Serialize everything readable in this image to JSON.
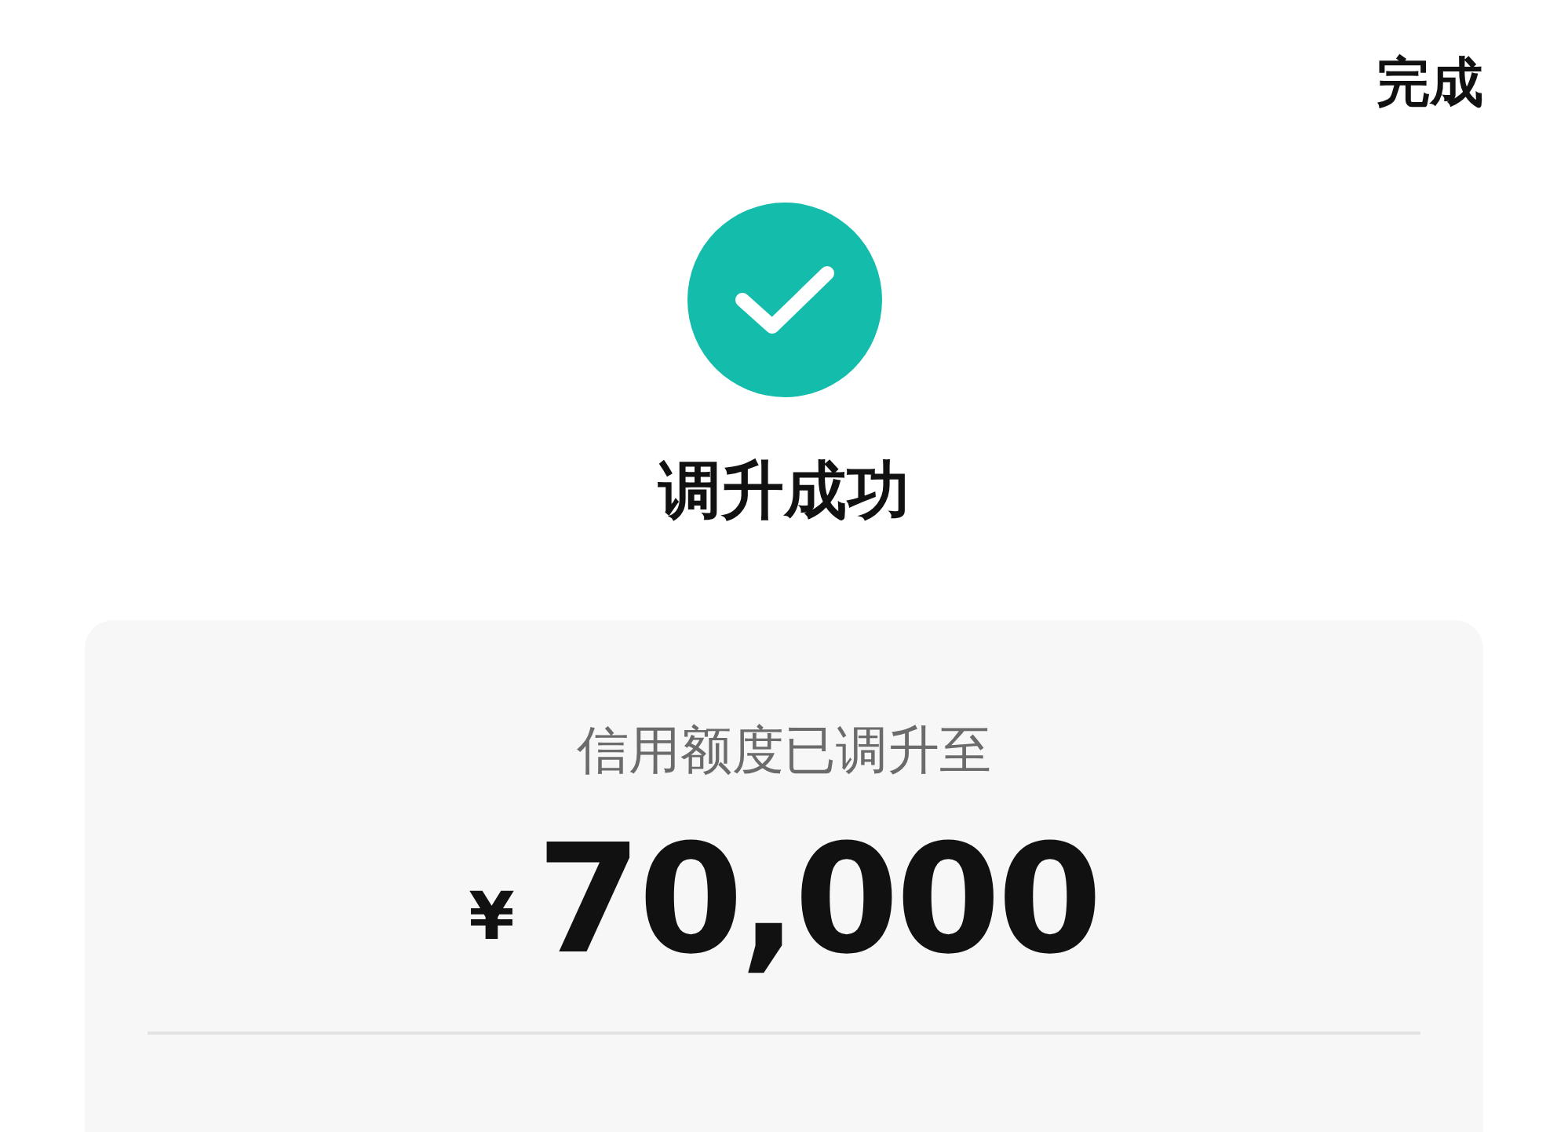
{
  "done_button": "完成",
  "status": {
    "title": "调升成功"
  },
  "card": {
    "label": "信用额度已调升至",
    "currency": "¥",
    "amount": "70,000"
  }
}
